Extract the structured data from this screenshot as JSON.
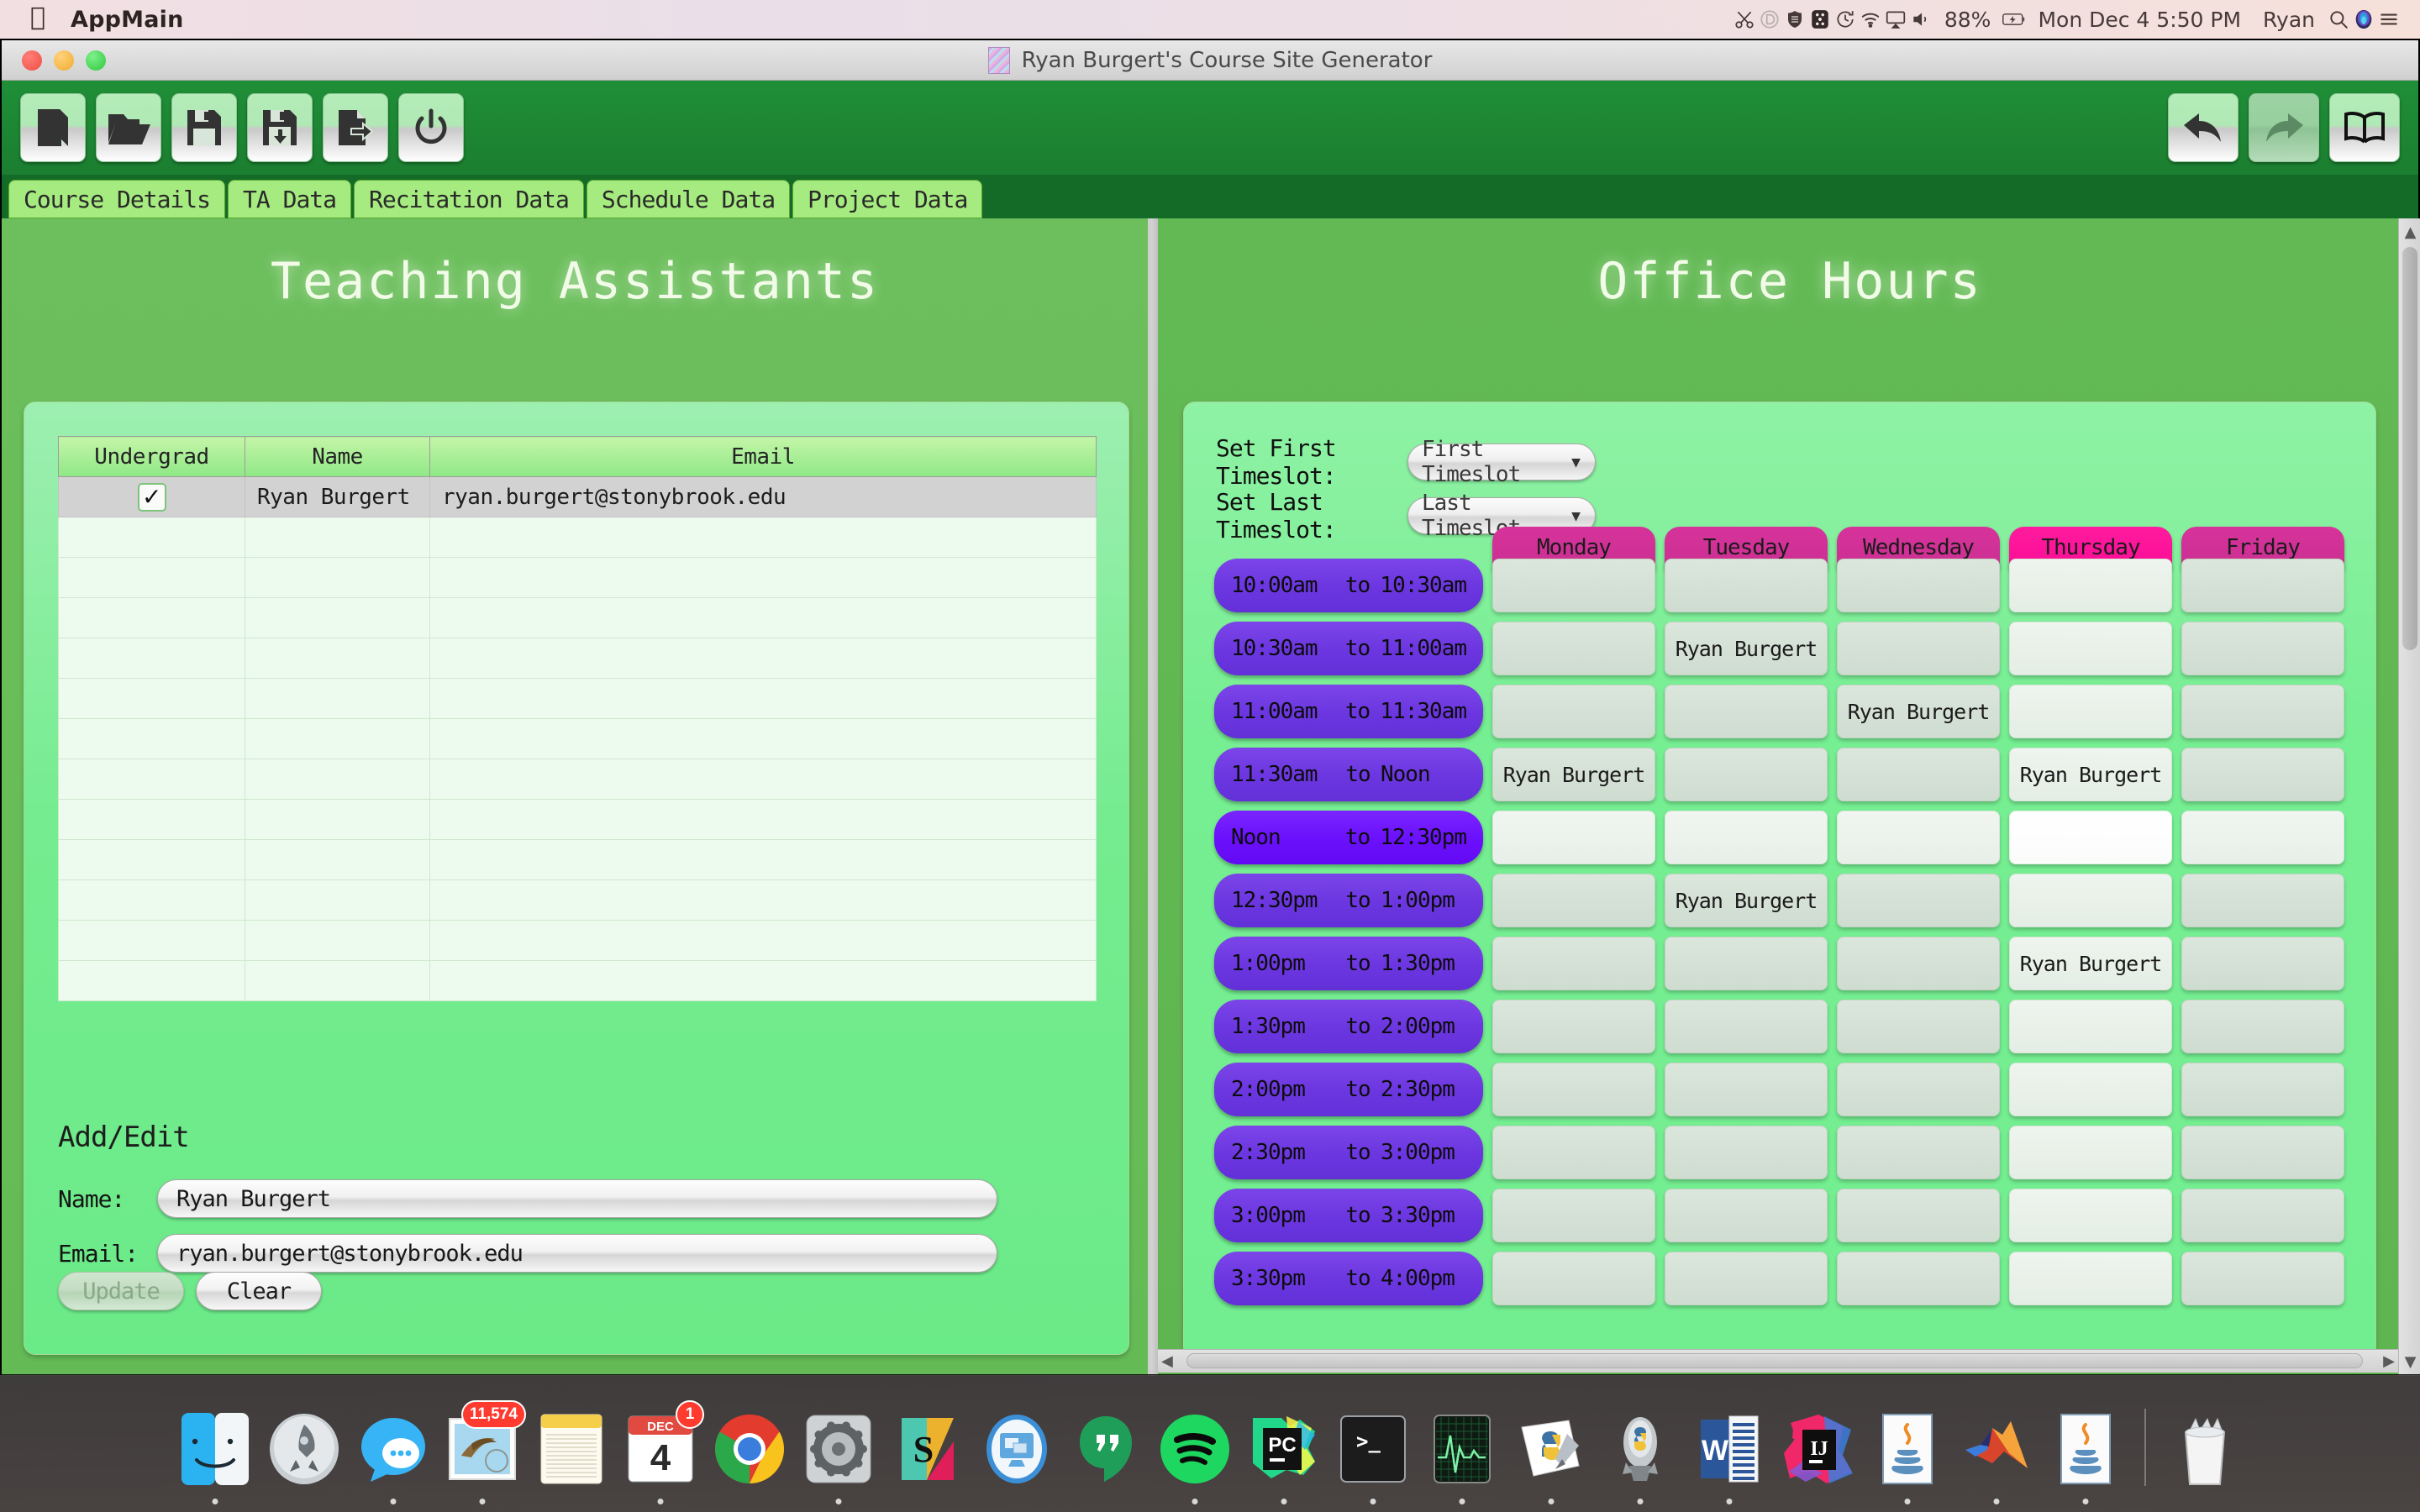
{
  "menubar": {
    "apple": "",
    "app_name": "AppMain",
    "status_items": [
      "scissors-icon",
      "circle-d-icon",
      "shield-icon",
      "grid-icon",
      "timemachine-icon",
      "wifi-icon",
      "airplay-icon",
      "volume-icon"
    ],
    "battery": "88%",
    "datetime": "Mon Dec 4  5:50 PM",
    "user": "Ryan",
    "search": "search-icon",
    "siri": "siri-icon",
    "notifications": "notification-center-icon"
  },
  "window": {
    "title": "Ryan Burgert's Course Site Generator",
    "toolbar": {
      "buttons": [
        {
          "name": "new-file-button",
          "icon": "file-icon"
        },
        {
          "name": "open-folder-button",
          "icon": "folder-open-icon"
        },
        {
          "name": "save-button",
          "icon": "floppy-disk-icon"
        },
        {
          "name": "save-as-button",
          "icon": "floppy-download-icon"
        },
        {
          "name": "export-button",
          "icon": "file-export-icon"
        },
        {
          "name": "exit-button",
          "icon": "power-icon"
        }
      ],
      "right_buttons": [
        {
          "name": "undo-button",
          "icon": "undo-arrow-icon",
          "enabled": true
        },
        {
          "name": "redo-button",
          "icon": "redo-arrow-icon",
          "enabled": false
        },
        {
          "name": "help-button",
          "icon": "book-icon",
          "enabled": true
        }
      ]
    },
    "tabs": [
      {
        "label": "Course Details",
        "selected": false
      },
      {
        "label": "TA Data",
        "selected": true
      },
      {
        "label": "Recitation Data",
        "selected": false
      },
      {
        "label": "Schedule Data",
        "selected": false
      },
      {
        "label": "Project Data",
        "selected": false
      }
    ]
  },
  "left_panel": {
    "title": "Teaching Assistants",
    "table": {
      "headers": [
        "Undergrad",
        "Name",
        "Email"
      ],
      "rows": [
        {
          "undergrad": "✓",
          "name": "Ryan Burgert",
          "email": "ryan.burgert@stonybrook.edu",
          "selected": true
        }
      ],
      "empty_row_count": 12
    },
    "add_edit": {
      "heading": "Add/Edit",
      "name_label": "Name:",
      "name_value": "Ryan Burgert",
      "email_label": "Email:",
      "email_value": "ryan.burgert@stonybrook.edu",
      "update_label": "Update",
      "update_enabled": false,
      "clear_label": "Clear"
    }
  },
  "right_panel": {
    "title": "Office Hours",
    "first_timeslot_label": "Set First Timeslot:",
    "first_timeslot_value": "First Timeslot",
    "last_timeslot_label": "Set Last Timeslot:",
    "last_timeslot_value": "Last Timeslot",
    "days": [
      {
        "label": "Monday",
        "highlighted": false
      },
      {
        "label": "Tuesday",
        "highlighted": false
      },
      {
        "label": "Wednesday",
        "highlighted": false
      },
      {
        "label": "Thursday",
        "highlighted": true
      },
      {
        "label": "Friday",
        "highlighted": false
      }
    ],
    "timeslots": [
      {
        "start": "10:00am",
        "sep": "to",
        "end": "10:30am",
        "highlighted": false,
        "cells": [
          "",
          "",
          "",
          "",
          ""
        ]
      },
      {
        "start": "10:30am",
        "sep": "to",
        "end": "11:00am",
        "highlighted": false,
        "cells": [
          "",
          "Ryan Burgert",
          "",
          "",
          ""
        ]
      },
      {
        "start": "11:00am",
        "sep": "to",
        "end": "11:30am",
        "highlighted": false,
        "cells": [
          "",
          "",
          "Ryan Burgert",
          "",
          ""
        ]
      },
      {
        "start": "11:30am",
        "sep": "to",
        "end": "Noon",
        "highlighted": false,
        "cells": [
          "Ryan Burgert",
          "",
          "",
          "Ryan Burgert",
          ""
        ]
      },
      {
        "start": "Noon",
        "sep": "to",
        "end": "12:30pm",
        "highlighted": true,
        "cells": [
          "",
          "",
          "",
          "",
          ""
        ]
      },
      {
        "start": "12:30pm",
        "sep": "to",
        "end": "1:00pm",
        "highlighted": false,
        "cells": [
          "",
          "Ryan Burgert",
          "",
          "",
          ""
        ]
      },
      {
        "start": "1:00pm",
        "sep": "to",
        "end": "1:30pm",
        "highlighted": false,
        "cells": [
          "",
          "",
          "",
          "Ryan Burgert",
          ""
        ]
      },
      {
        "start": "1:30pm",
        "sep": "to",
        "end": "2:00pm",
        "highlighted": false,
        "cells": [
          "",
          "",
          "",
          "",
          ""
        ]
      },
      {
        "start": "2:00pm",
        "sep": "to",
        "end": "2:30pm",
        "highlighted": false,
        "cells": [
          "",
          "",
          "",
          "",
          ""
        ]
      },
      {
        "start": "2:30pm",
        "sep": "to",
        "end": "3:00pm",
        "highlighted": false,
        "cells": [
          "",
          "",
          "",
          "",
          ""
        ]
      },
      {
        "start": "3:00pm",
        "sep": "to",
        "end": "3:30pm",
        "highlighted": false,
        "cells": [
          "",
          "",
          "",
          "",
          ""
        ]
      },
      {
        "start": "3:30pm",
        "sep": "to",
        "end": "4:00pm",
        "highlighted": false,
        "cells": [
          "",
          "",
          "",
          "",
          ""
        ]
      }
    ]
  },
  "dock": {
    "apps": [
      {
        "name": "finder",
        "badge": ""
      },
      {
        "name": "launchpad",
        "badge": ""
      },
      {
        "name": "messages",
        "badge": ""
      },
      {
        "name": "mail",
        "badge": "11,574"
      },
      {
        "name": "notes",
        "badge": ""
      },
      {
        "name": "calendar",
        "badge": "1",
        "month": "DEC",
        "day": "4"
      },
      {
        "name": "chrome",
        "badge": ""
      },
      {
        "name": "system-preferences",
        "badge": ""
      },
      {
        "name": "slack",
        "badge": ""
      },
      {
        "name": "screen-sharing",
        "badge": ""
      },
      {
        "name": "hangouts",
        "badge": ""
      },
      {
        "name": "spotify",
        "badge": ""
      },
      {
        "name": "pycharm",
        "badge": ""
      },
      {
        "name": "terminal",
        "badge": ""
      },
      {
        "name": "activity-monitor",
        "badge": ""
      },
      {
        "name": "idle",
        "badge": ""
      },
      {
        "name": "python-launcher",
        "badge": ""
      },
      {
        "name": "microsoft-word",
        "badge": ""
      },
      {
        "name": "intellij-idea",
        "badge": ""
      },
      {
        "name": "java-app-1",
        "badge": ""
      },
      {
        "name": "matlab",
        "badge": ""
      },
      {
        "name": "java-app-2",
        "badge": ""
      }
    ],
    "trash": "trash-icon"
  },
  "colors": {
    "toolbar_green": "#1f8f37",
    "tab_green": "#a6eb7f",
    "panel_green": "#63ba54",
    "timeslot_purple": "#6b36e0",
    "timeslot_purple_hot": "#6a10fb",
    "day_pink": "#cc2f92",
    "day_pink_hot": "#fb0d96"
  }
}
